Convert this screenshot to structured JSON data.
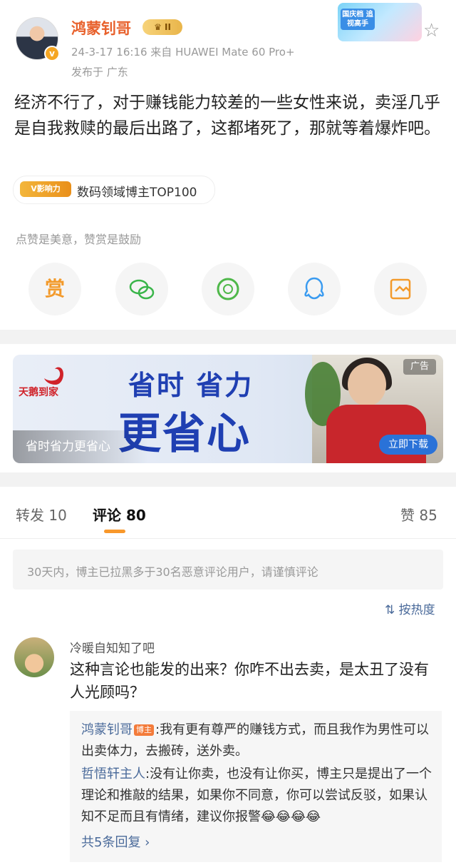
{
  "post": {
    "author": "鸿蒙钊哥",
    "level_badge": "II",
    "verified_mark": "v",
    "meta": "24-3-17 16:16   来自 HUAWEI Mate 60 Pro+",
    "location": "发布于 广东",
    "decoration_text": "国庆档 追视高手",
    "body": "经济不行了，对于赚钱能力较差的一些女性来说，卖淫几乎是自我救赎的最后出路了，这都堵死了，那就等着爆炸吧。",
    "influence_label": "V影响力",
    "influence_text": "数码领域博主TOP100",
    "like_hint": "点赞是美意，赞赏是鼓励",
    "share_icons": [
      "reward-icon",
      "wechat-icon",
      "moments-icon",
      "qq-icon",
      "save-image-icon"
    ],
    "reward_glyph": "赏"
  },
  "ad": {
    "logo_text": "天鹅到家",
    "title_line1": "省时 省力",
    "title_line2": "更省心",
    "caption": "省时省力更省心",
    "tag": "广告",
    "download_label": "立即下载"
  },
  "tabs": {
    "repost": "转发 10",
    "comment": "评论 80",
    "like": "赞 85"
  },
  "notice": "30天内，博主已拉黑多于30名恶意评论用户，请谨慎评论",
  "sort_label": "按热度",
  "comment": {
    "author": "冷暖自知知了吧",
    "text": "这种言论也能发的出来？你咋不出去卖，是太丑了没有人光顾吗？",
    "replies": [
      {
        "name": "鸿蒙钊哥",
        "host_tag": "博主",
        "text": ":我有更有尊严的赚钱方式，而且我作为男性可以出卖体力，去搬砖，送外卖。"
      },
      {
        "name": "哲悟轩主人",
        "host_tag": "",
        "text": ":没有让你卖，也没有让你买，博主只是提出了一个理论和推敲的结果，如果你不同意，你可以尝试反驳，如果认知不足而且有情绪，建议你报警😂😂😂😂"
      }
    ],
    "more_replies": "共5条回复 ›"
  },
  "colors": {
    "accent": "#f8982b",
    "link": "#4a6a9a",
    "author": "#e8612c"
  }
}
